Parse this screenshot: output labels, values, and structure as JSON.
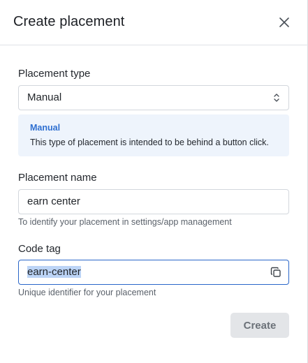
{
  "dialog": {
    "title": "Create placement"
  },
  "placement_type": {
    "label": "Placement type",
    "value": "Manual",
    "info_title": "Manual",
    "info_text": "This type of placement is intended to be behind a button click."
  },
  "placement_name": {
    "label": "Placement name",
    "value": "earn center",
    "helper": "To identify your placement in settings/app management"
  },
  "code_tag": {
    "label": "Code tag",
    "value": "earn-center",
    "helper": "Unique identifier for your placement"
  },
  "footer": {
    "create_label": "Create"
  },
  "colors": {
    "accent": "#2e6fd1",
    "focus_border": "#2a66c9",
    "info_bg": "#eef4fc",
    "disabled_button": "#e3e5e8"
  }
}
